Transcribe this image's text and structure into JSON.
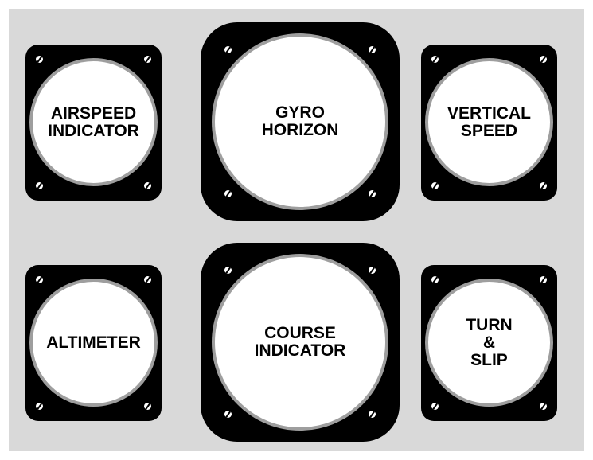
{
  "panel": {
    "background_color": "#d9d9d9",
    "gauges": [
      {
        "id": "airspeed",
        "label": "AIRSPEED\nINDICATOR",
        "size": "small"
      },
      {
        "id": "gyro-horizon",
        "label": "GYRO\nHORIZON",
        "size": "large"
      },
      {
        "id": "vertical-speed",
        "label": "VERTICAL\nSPEED",
        "size": "small"
      },
      {
        "id": "altimeter",
        "label": "ALTIMETER",
        "size": "small"
      },
      {
        "id": "course-indicator",
        "label": "COURSE\nINDICATOR",
        "size": "large"
      },
      {
        "id": "turn-slip",
        "label": "TURN\n&\nSLIP",
        "size": "small"
      }
    ]
  },
  "colors": {
    "bezel": "#000000",
    "face": "#ffffff",
    "rim": "#9e9e9e",
    "screw": "#ffffff",
    "text": "#000000"
  }
}
